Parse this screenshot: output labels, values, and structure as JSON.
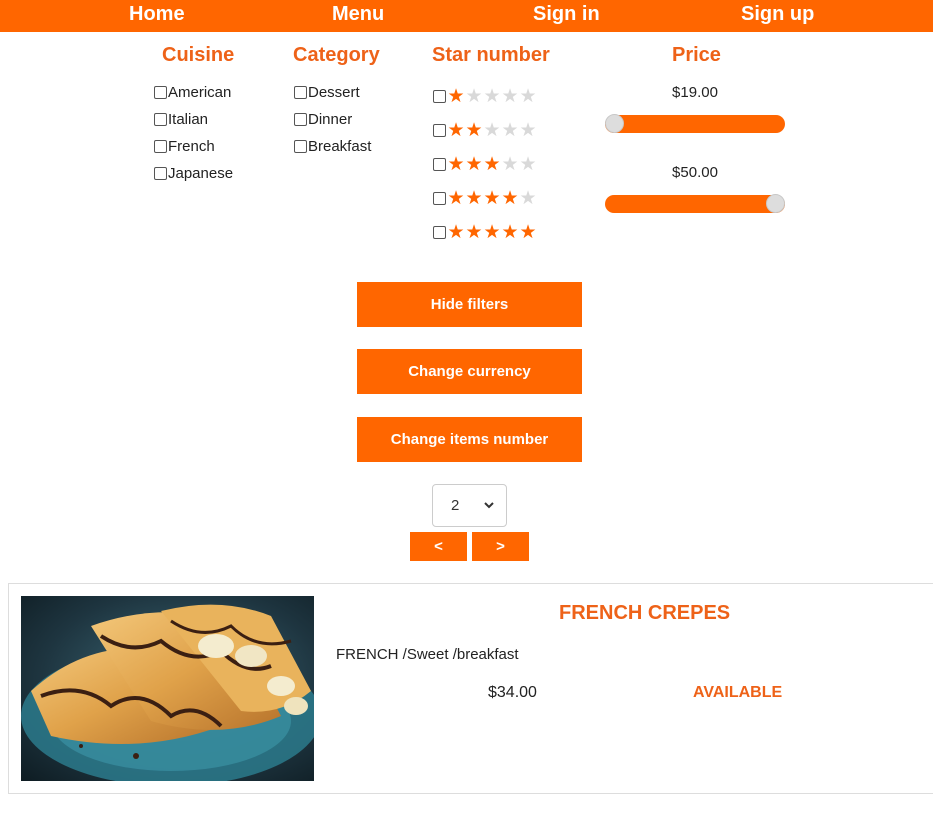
{
  "nav": {
    "home": "Home",
    "menu": "Menu",
    "sign_in": "Sign in",
    "sign_up": "Sign up"
  },
  "filters": {
    "cuisine": {
      "heading": "Cuisine",
      "options": [
        "American",
        "Italian",
        "French",
        "Japanese"
      ]
    },
    "category": {
      "heading": "Category",
      "options": [
        "Dessert",
        "Dinner",
        "Breakfast"
      ]
    },
    "stars": {
      "heading": "Star number",
      "levels": [
        1,
        2,
        3,
        4,
        5
      ],
      "max": 5
    },
    "price": {
      "heading": "Price",
      "min_label": "$19.00",
      "max_label": "$50.00",
      "min_fraction": 0.0,
      "max_fraction": 1.0
    }
  },
  "actions": {
    "hide_filters": "Hide filters",
    "change_currency": "Change currency",
    "change_items_number": "Change items number"
  },
  "pagination": {
    "items_select_value": "2",
    "prev": "<",
    "next": ">"
  },
  "product": {
    "title": "FRENCH CREPES",
    "meta": "FRENCH /Sweet /breakfast",
    "price": "$34.00",
    "status": "AVAILABLE"
  },
  "colors": {
    "accent": "#ff6600",
    "heading": "#ee6218",
    "star_off": "#d9d9d9"
  }
}
